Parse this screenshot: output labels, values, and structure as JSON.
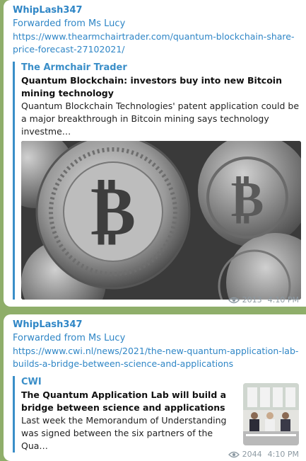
{
  "messages": [
    {
      "sender": "WhipLash347",
      "forwarded": "Forwarded from Ms Lucy",
      "url": "https://www.thearmchairtrader.com/quantum-blockchain-share-price-forecast-27102021/",
      "preview": {
        "site": "The Armchair Trader",
        "title": "Quantum Blockchain: investors buy into new Bitcoin mining technology",
        "description": "Quantum Blockchain Technologies' patent application could be a major breakthrough in Bitcoin mining says technology investme…",
        "image": "bitcoin-coins-photo"
      },
      "views": "2013",
      "time": "4:10 PM"
    },
    {
      "sender": "WhipLash347",
      "forwarded": "Forwarded from Ms Lucy",
      "url": "https://www.cwi.nl/news/2021/the-new-quantum-application-lab-builds-a-bridge-between-science-and-applications",
      "preview": {
        "site": "CWI",
        "title": "The Quantum Application Lab will build a bridge between science and applications",
        "description": "Last week the Memorandum of Understanding was signed between the six partners of the Qua…",
        "image": "signing-ceremony-photo"
      },
      "views": "2044",
      "time": "4:10 PM"
    }
  ],
  "colors": {
    "accent": "#2f86c6",
    "chat_background": "#8fae6a",
    "meta": "#8d9aa3"
  }
}
